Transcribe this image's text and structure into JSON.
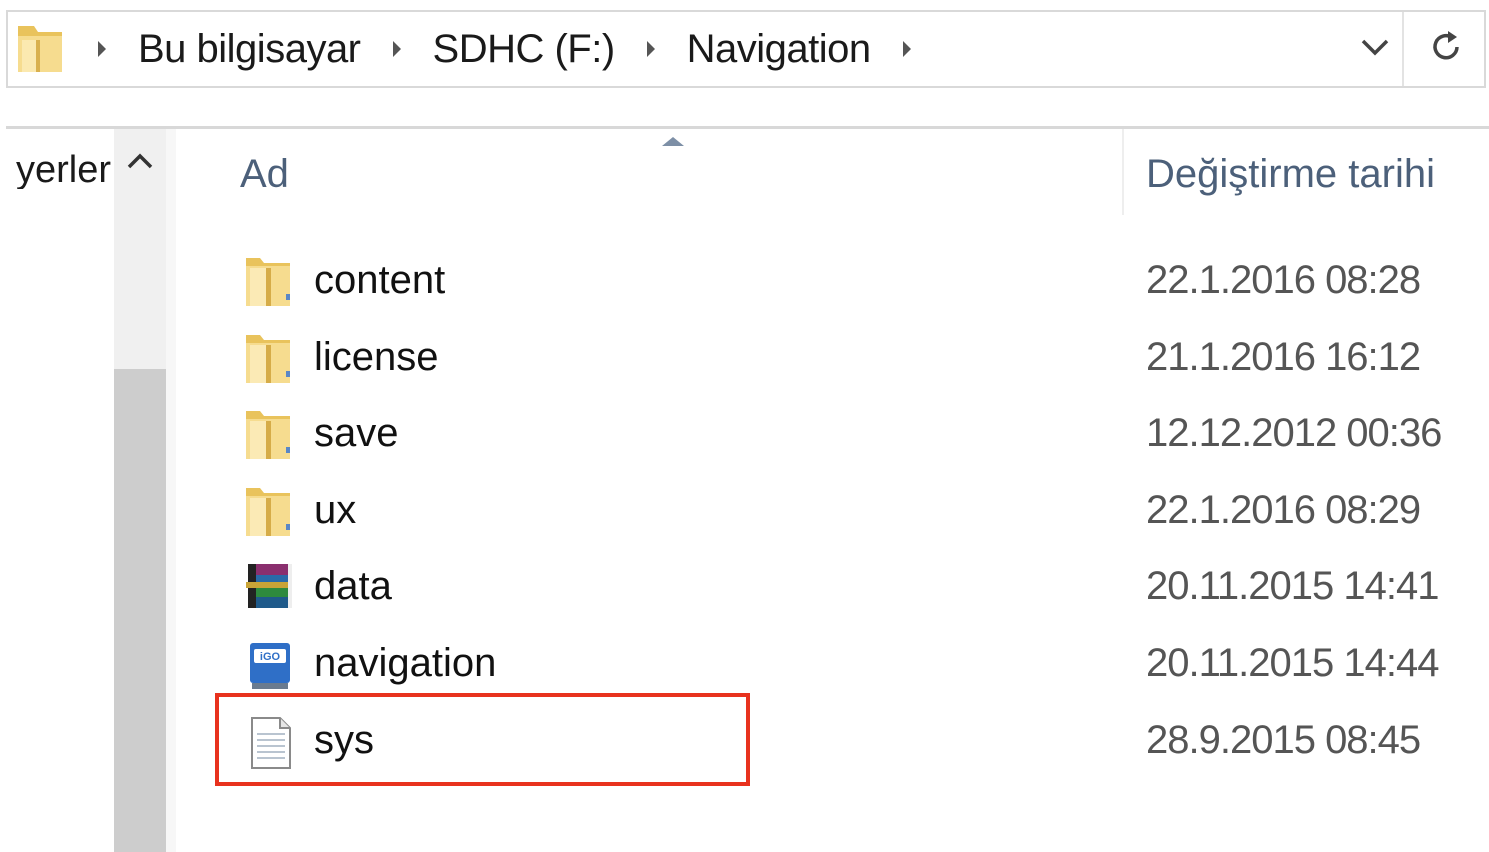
{
  "address_bar": {
    "breadcrumbs": [
      "Bu bilgisayar",
      "SDHC (F:)",
      "Navigation"
    ]
  },
  "nav_pane": {
    "label": "yerleri"
  },
  "file_list": {
    "columns": {
      "name": "Ad",
      "modified": "Değiştirme tarihi"
    },
    "rows": [
      {
        "name": "content",
        "modified": "22.1.2016 08:28",
        "icon": "folder-icon"
      },
      {
        "name": "license",
        "modified": "21.1.2016 16:12",
        "icon": "folder-icon"
      },
      {
        "name": "save",
        "modified": "12.12.2012 00:36",
        "icon": "folder-icon"
      },
      {
        "name": "ux",
        "modified": "22.1.2016 08:29",
        "icon": "folder-icon"
      },
      {
        "name": "data",
        "modified": "20.11.2015 14:41",
        "icon": "winrar-archive-icon"
      },
      {
        "name": "navigation",
        "modified": "20.11.2015 14:44",
        "icon": "igo-app-icon"
      },
      {
        "name": "sys",
        "modified": "28.9.2015 08:45",
        "icon": "text-file-icon"
      }
    ]
  },
  "highlight": {
    "target": "sys",
    "color": "#e8321e"
  },
  "colors": {
    "header_text": "#4c607a",
    "folder_yellow": "#f2d27a"
  }
}
